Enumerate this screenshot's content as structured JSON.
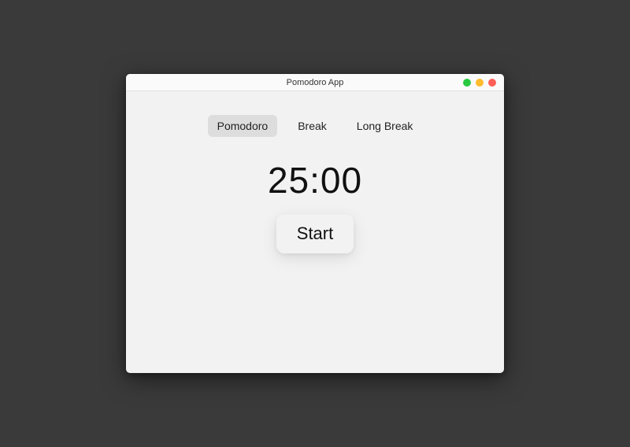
{
  "window": {
    "title": "Pomodoro App"
  },
  "tabs": {
    "pomodoro": "Pomodoro",
    "break": "Break",
    "long_break": "Long Break",
    "active": "pomodoro"
  },
  "timer": {
    "display": "25:00"
  },
  "controls": {
    "start_label": "Start"
  }
}
